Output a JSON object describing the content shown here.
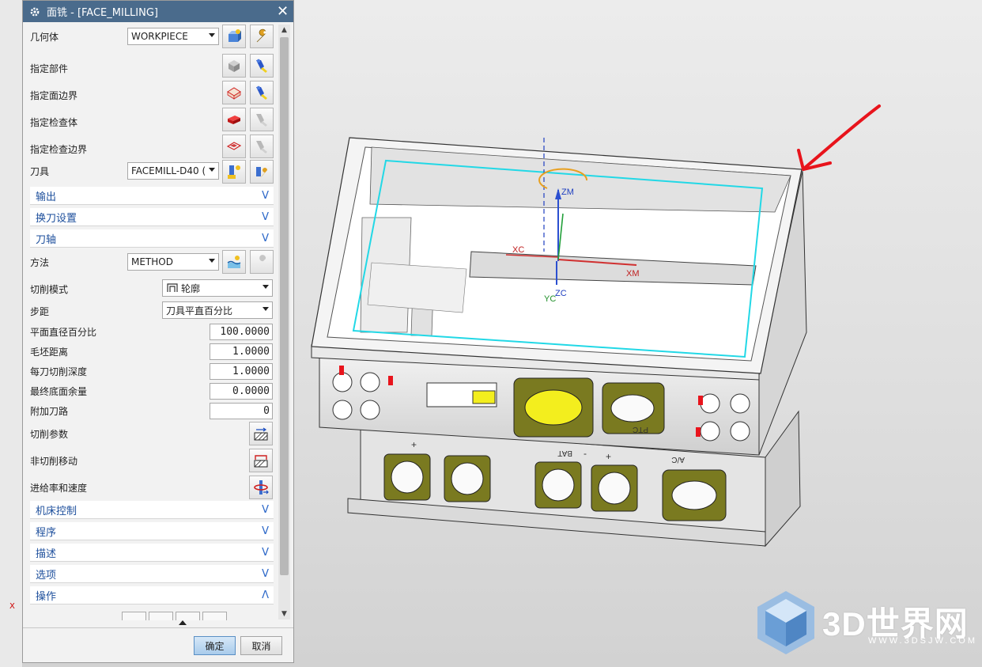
{
  "dialog": {
    "title": "面铣 - [FACE_MILLING]",
    "rows": {
      "geometry": "几何体",
      "part": "指定部件",
      "face_boundary": "指定面边界",
      "check_body": "指定检查体",
      "check_boundary": "指定检查边界",
      "tool": "刀具",
      "method": "方法",
      "cut_pattern": "切削模式",
      "stepover": "步距",
      "flat_diameter_pct": "平面直径百分比",
      "blank_distance": "毛坯距离",
      "depth_per_cut": "每刀切削深度",
      "final_floor_stock": "最终底面余量",
      "extra_passes": "附加刀路",
      "cutting_params": "切削参数",
      "non_cutting_moves": "非切削移动",
      "feeds_speeds": "进给率和速度"
    },
    "values": {
      "geometry": "WORKPIECE",
      "tool": "FACEMILL-D40 (",
      "method": "METHOD",
      "cut_pattern": "轮廓",
      "stepover": "刀具平直百分比",
      "flat_diameter_pct": "100.0000",
      "blank_distance": "1.0000",
      "depth_per_cut": "1.0000",
      "final_floor_stock": "0.0000",
      "extra_passes": "0"
    },
    "sections": {
      "output": "输出",
      "tool_change": "换刀设置",
      "tool_axis": "刀轴",
      "machine_control": "机床控制",
      "program": "程序",
      "description": "描述",
      "options": "选项",
      "actions": "操作"
    },
    "buttons": {
      "ok": "确定",
      "cancel": "取消"
    }
  },
  "viewport": {
    "axis_labels": {
      "xc": "XC",
      "xm": "XM",
      "yc": "YC",
      "zc": "ZC",
      "zm": "ZM"
    },
    "left_axis_mark": "X",
    "part_labels": {
      "bat": "BAT",
      "ptc": "PTC",
      "ac": "A/C",
      "plus": "+",
      "minus": "-"
    },
    "logo": {
      "name": "3D世界网",
      "url": "WWW.3DSJW.COM"
    },
    "colors": {
      "boundary": "#22d8e6",
      "annotation_arrow": "#e8141c",
      "connector_face": "#7a7a20",
      "highlight": "#f3ee1e"
    }
  }
}
